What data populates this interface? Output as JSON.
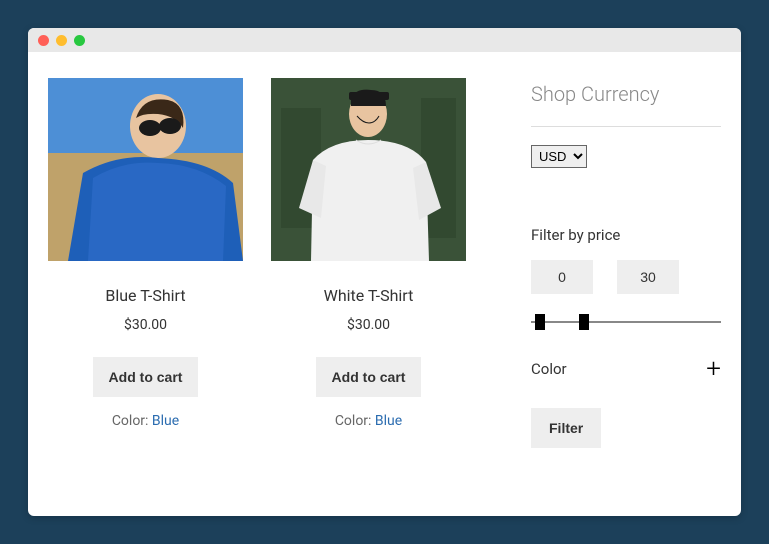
{
  "sidebar": {
    "currency_heading": "Shop Currency",
    "currency_options": [
      "USD"
    ],
    "currency_selected": "USD",
    "filter_price_heading": "Filter by price",
    "price_min": "0",
    "price_max": "30",
    "color_heading": "Color",
    "filter_button": "Filter"
  },
  "products": [
    {
      "title": "Blue T-Shirt",
      "price": "$30.00",
      "add_label": "Add to cart",
      "color_prefix": "Color: ",
      "color_value": "Blue"
    },
    {
      "title": "White T-Shirt",
      "price": "$30.00",
      "add_label": "Add to cart",
      "color_prefix": "Color: ",
      "color_value": "Blue"
    }
  ]
}
